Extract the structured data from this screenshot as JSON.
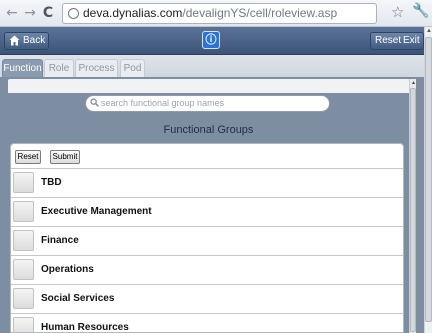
{
  "browser": {
    "url_domain": "deva.dynalias.com",
    "url_path": "/devalignYS/cell/roleview.asp",
    "back_glyph": "←",
    "forward_glyph": "→",
    "reload_glyph": "C",
    "star_glyph": "☆",
    "wrench_glyph": "🔧"
  },
  "header": {
    "back_label": "Back",
    "info_glyph": "ⓘ",
    "reset_label": "Reset",
    "exit_label": "Exit"
  },
  "tabs": [
    {
      "label": "Function",
      "active": true
    },
    {
      "label": "Role",
      "active": false
    },
    {
      "label": "Process",
      "active": false
    },
    {
      "label": "Pod",
      "active": false
    }
  ],
  "search": {
    "placeholder": "search functional group names"
  },
  "section_title": "Functional Groups",
  "form": {
    "reset_label": "Reset",
    "submit_label": "Submit"
  },
  "groups": [
    {
      "label": "TBD"
    },
    {
      "label": "Executive Management"
    },
    {
      "label": "Finance"
    },
    {
      "label": "Operations"
    },
    {
      "label": "Social Services"
    },
    {
      "label": "Human Resources"
    }
  ],
  "colors": {
    "header_bg": "#4a6388",
    "content_bg": "#7d8ea3",
    "info_blue": "#2a73d6"
  }
}
